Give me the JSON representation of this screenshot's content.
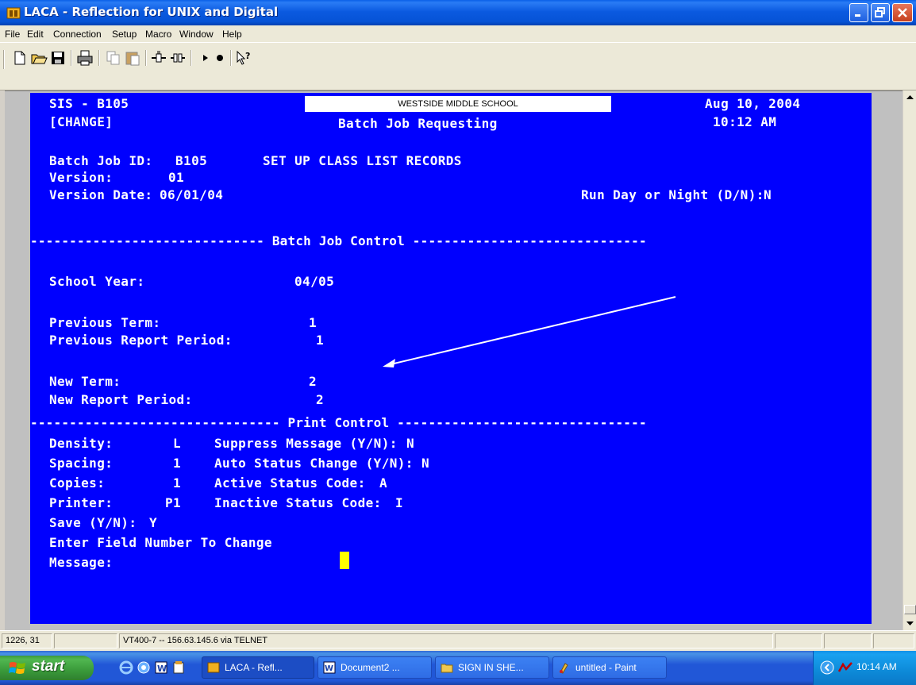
{
  "window": {
    "title": "LACA - Reflection for UNIX and Digital"
  },
  "menu": [
    "File",
    "Edit",
    "Connection",
    "Setup",
    "Macro",
    "Window",
    "Help"
  ],
  "toolbar_icons": [
    "new-icon",
    "open-icon",
    "save-icon",
    "print-icon",
    "copy-icon",
    "paste-icon",
    "connect-icon",
    "disconnect-icon",
    "play-macro-icon",
    "record-macro-icon",
    "help-icon"
  ],
  "terminal": {
    "system": "SIS - B105",
    "mode": "[CHANGE]",
    "school": "WESTSIDE MIDDLE SCHOOL",
    "screen_title": "Batch Job Requesting",
    "date": "Aug 10, 2004",
    "time": "10:12 AM",
    "batch_job_id_label": "Batch Job ID:",
    "batch_job_id": "B105",
    "job_description": "SET UP CLASS LIST RECORDS",
    "version_label": "Version:",
    "version": "01",
    "version_date_label": "Version Date:",
    "version_date": "06/01/04",
    "run_day_night_label": "Run Day or Night (D/N):",
    "run_day_night": "N",
    "batch_control_divider": "------------------------------ Batch Job Control ------------------------------",
    "school_year_label": "School Year:",
    "school_year": "04/05",
    "previous_term_label": "Previous Term:",
    "previous_term": "1",
    "previous_report_period_label": "Previous Report Period:",
    "previous_report_period": "1",
    "new_term_label": "New Term:",
    "new_term": "2",
    "new_report_period_label": "New Report Period:",
    "new_report_period": "2",
    "print_control_divider": "-------------------------------- Print Control --------------------------------",
    "density_label": "Density:",
    "density": "L",
    "spacing_label": "Spacing:",
    "spacing": "1",
    "copies_label": "Copies:",
    "copies": "1",
    "printer_label": "Printer:",
    "printer": "P1",
    "suppress_message_label": "Suppress Message (Y/N):",
    "suppress_message": "N",
    "auto_status_change_label": "Auto Status Change (Y/N):",
    "auto_status_change": "N",
    "active_status_code_label": "Active Status Code:",
    "active_status_code": "A",
    "inactive_status_code_label": "Inactive Status Code:",
    "inactive_status_code": "I",
    "save_label": "Save (Y/N):",
    "save": "Y",
    "prompt": "Enter Field Number To Change",
    "message_label": "Message:"
  },
  "statusbar": {
    "cursor_position": "1226, 31",
    "connection": "VT400-7 -- 156.63.145.6 via TELNET"
  },
  "taskbar": {
    "start_label": "start",
    "tasks": [
      "LACA - Refl...",
      "Document2 ...",
      "SIGN IN SHE...",
      "untitled - Paint"
    ],
    "clock": "10:14 AM"
  },
  "colors": {
    "terminal_bg": "#0000fe",
    "terminal_fg": "#ffffff",
    "cursor": "#ffff00",
    "title_bar": "#0653d6"
  }
}
